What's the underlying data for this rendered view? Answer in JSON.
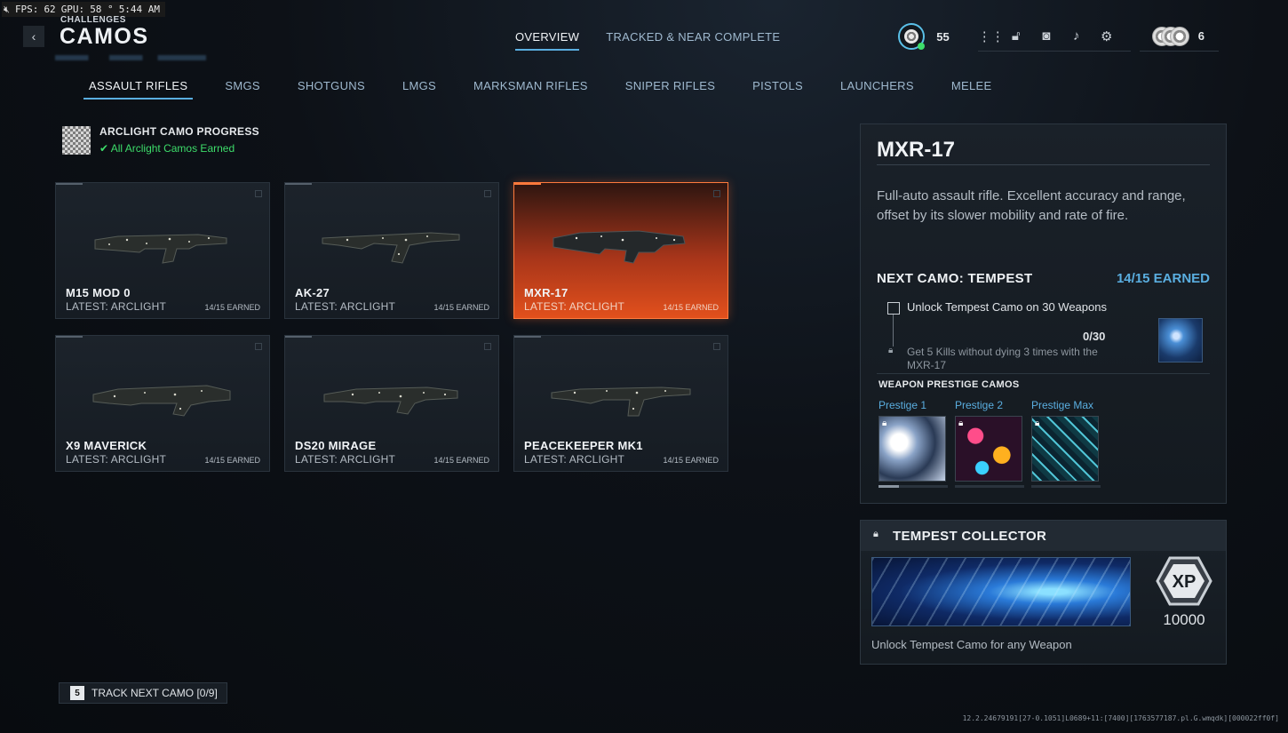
{
  "perf": {
    "mute_icon": "speaker-mute-icon",
    "fps_label": "FPS:",
    "fps": "62",
    "gpu_label": "GPU:",
    "gpu": "58 °",
    "time": "5:44 AM"
  },
  "header": {
    "back_icon": "chevron-left-icon",
    "subtitle": "CHALLENGES",
    "title": "CAMOS"
  },
  "top_tabs": [
    {
      "label": "OVERVIEW",
      "active": true
    },
    {
      "label": "TRACKED & NEAR COMPLETE",
      "active": false
    }
  ],
  "hud": {
    "rank": "55",
    "icons": [
      "grid-menu-icon",
      "unlock-icon",
      "camera-icon",
      "bell-icon",
      "gear-icon"
    ],
    "currency": "6"
  },
  "categories": [
    {
      "label": "ASSAULT RIFLES",
      "active": true
    },
    {
      "label": "SMGS",
      "active": false
    },
    {
      "label": "SHOTGUNS",
      "active": false
    },
    {
      "label": "LMGS",
      "active": false
    },
    {
      "label": "MARKSMAN RIFLES",
      "active": false
    },
    {
      "label": "SNIPER RIFLES",
      "active": false
    },
    {
      "label": "PISTOLS",
      "active": false
    },
    {
      "label": "LAUNCHERS",
      "active": false
    },
    {
      "label": "MELEE",
      "active": false
    }
  ],
  "progress": {
    "title": "ARCLIGHT CAMO PROGRESS",
    "status": "All Arclight Camos Earned",
    "status_icon": "checkmark-icon"
  },
  "weapons": [
    {
      "name": "M15 MOD 0",
      "latest": "LATEST: ARCLIGHT",
      "earned": "14/15 EARNED",
      "selected": false
    },
    {
      "name": "AK-27",
      "latest": "LATEST: ARCLIGHT",
      "earned": "14/15 EARNED",
      "selected": false
    },
    {
      "name": "MXR-17",
      "latest": "LATEST: ARCLIGHT",
      "earned": "14/15 EARNED",
      "selected": true
    },
    {
      "name": "X9 MAVERICK",
      "latest": "LATEST: ARCLIGHT",
      "earned": "14/15 EARNED",
      "selected": false
    },
    {
      "name": "DS20 MIRAGE",
      "latest": "LATEST: ARCLIGHT",
      "earned": "14/15 EARNED",
      "selected": false
    },
    {
      "name": "PEACEKEEPER MK1",
      "latest": "LATEST: ARCLIGHT",
      "earned": "14/15 EARNED",
      "selected": false
    }
  ],
  "detail": {
    "name": "MXR-17",
    "description": "Full-auto assault rifle. Excellent accuracy and range, offset by its slower mobility and rate of fire.",
    "next_camo": "NEXT CAMO: TEMPEST",
    "earned": "14/15 EARNED",
    "task": "Unlock Tempest Camo on 30 Weapons",
    "task_progress": "0/30",
    "subtask": "Get 5 Kills without dying 3 times with the MXR-17",
    "prestige_title": "WEAPON PRESTIGE CAMOS",
    "prestige": [
      {
        "label": "Prestige 1",
        "locked": true,
        "progress": 0.3
      },
      {
        "label": "Prestige 2",
        "locked": true,
        "progress": 0
      },
      {
        "label": "Prestige Max",
        "locked": true,
        "progress": 0
      }
    ]
  },
  "collector": {
    "title": "TEMPEST COLLECTOR",
    "xp_label": "XP",
    "xp": "10000",
    "description": "Unlock Tempest Camo for any Weapon"
  },
  "footer": {
    "track_key": "5",
    "track_label": "TRACK NEXT CAMO [0/9]",
    "build": "12.2.24679191[27-0.1051]L0689+11:[7400][1763577187.pl.G.wmqdk][000022ff0f]"
  },
  "colors": {
    "accent": "#5aaee0",
    "selected": "#e2501c",
    "success": "#3ddc6a"
  }
}
